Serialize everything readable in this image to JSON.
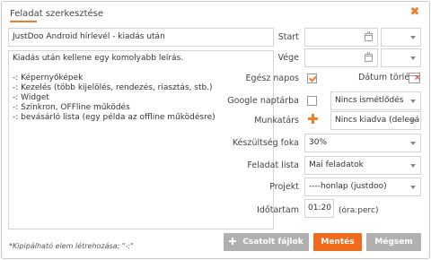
{
  "dialog": {
    "title": "Feladat szerkesztése",
    "close_icon": "close-icon",
    "accent_color": "#f07c2c"
  },
  "task": {
    "title_value": "JustDoo Android hírlevél - kiadás után",
    "description": "Kiadás után kellene egy komolyabb leírás.\n\n-: Képernyőképek\n-: Kezelés (több kijelölés, rendezés, riasztás, stb.)\n-: Widget\n-: Szinkron, OFFline működés\n-: bevásárló lista (egy példa az offline működésre)",
    "hint": "*Kipipálható elem létrehozása: \"-:\""
  },
  "fields": {
    "start": {
      "label": "Start",
      "value": ""
    },
    "end": {
      "label": "Vége",
      "value": ""
    },
    "all_day": {
      "label": "Egész napos",
      "checked": true
    },
    "date_delete": {
      "label": "Dátum törlés"
    },
    "google_calendar": {
      "label": "Google naptárba",
      "checked": false,
      "repeat_value": "Nincs ismétlődés"
    },
    "assignee": {
      "label": "Munkatárs",
      "value": "Nincs kiadva (delegá"
    },
    "progress": {
      "label": "Készültség foka",
      "value": "30%"
    },
    "task_list": {
      "label": "Feladat lista",
      "value": "Mai feladatok"
    },
    "project": {
      "label": "Projekt",
      "value": "----honlap (justdoo)"
    },
    "duration": {
      "label": "Időtartam",
      "value": "01:20",
      "unit": "(óra:perc)"
    }
  },
  "buttons": {
    "attach": "Csatolt fájlok",
    "save": "Mentés",
    "cancel": "Mégsem"
  }
}
